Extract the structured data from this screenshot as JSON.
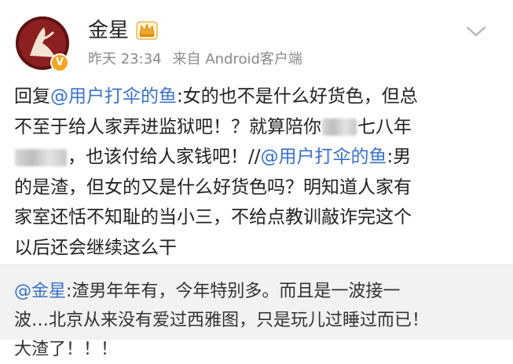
{
  "post": {
    "username": "金星",
    "verified_badge": "V",
    "time": "昨天 23:34",
    "source": "来自 Android客户端",
    "icons": [
      "avatar",
      "crown-icon",
      "chevron-down-icon",
      "verified-badge-icon"
    ],
    "body": {
      "line1_prefix": "回复",
      "line1_mention": "@用户打伞的鱼",
      "line1_rest": ":女的也不是什么好货色，但总",
      "line2_a": "不至于给人家弄进监狱吧！？就算陪你",
      "line2_b": "七八年",
      "line3_rest": "，也该付给人家钱吧！//",
      "line3_mention": "@用户打伞的鱼",
      "line3_end": ":男",
      "line4": "的是渣，但女的又是什么好货色吗？明知道人家有",
      "line5": "家室还恬不知耻的当小三，不给点教训敲诈完这个",
      "line6": "以后还会继续这么干"
    }
  },
  "comment": {
    "mention": "@金星",
    "line1_rest": ":渣男年年有，今年特别多。而且是一波接一",
    "line2": "波…北京从来没有爱过西雅图，只是玩儿过睡过而已！",
    "line3": "大渣了！！！"
  },
  "colors": {
    "mention": "#3a71c8",
    "meta": "#8a8a8a",
    "comment_bg": "#f2f2f2",
    "badge": "#f5a623"
  }
}
